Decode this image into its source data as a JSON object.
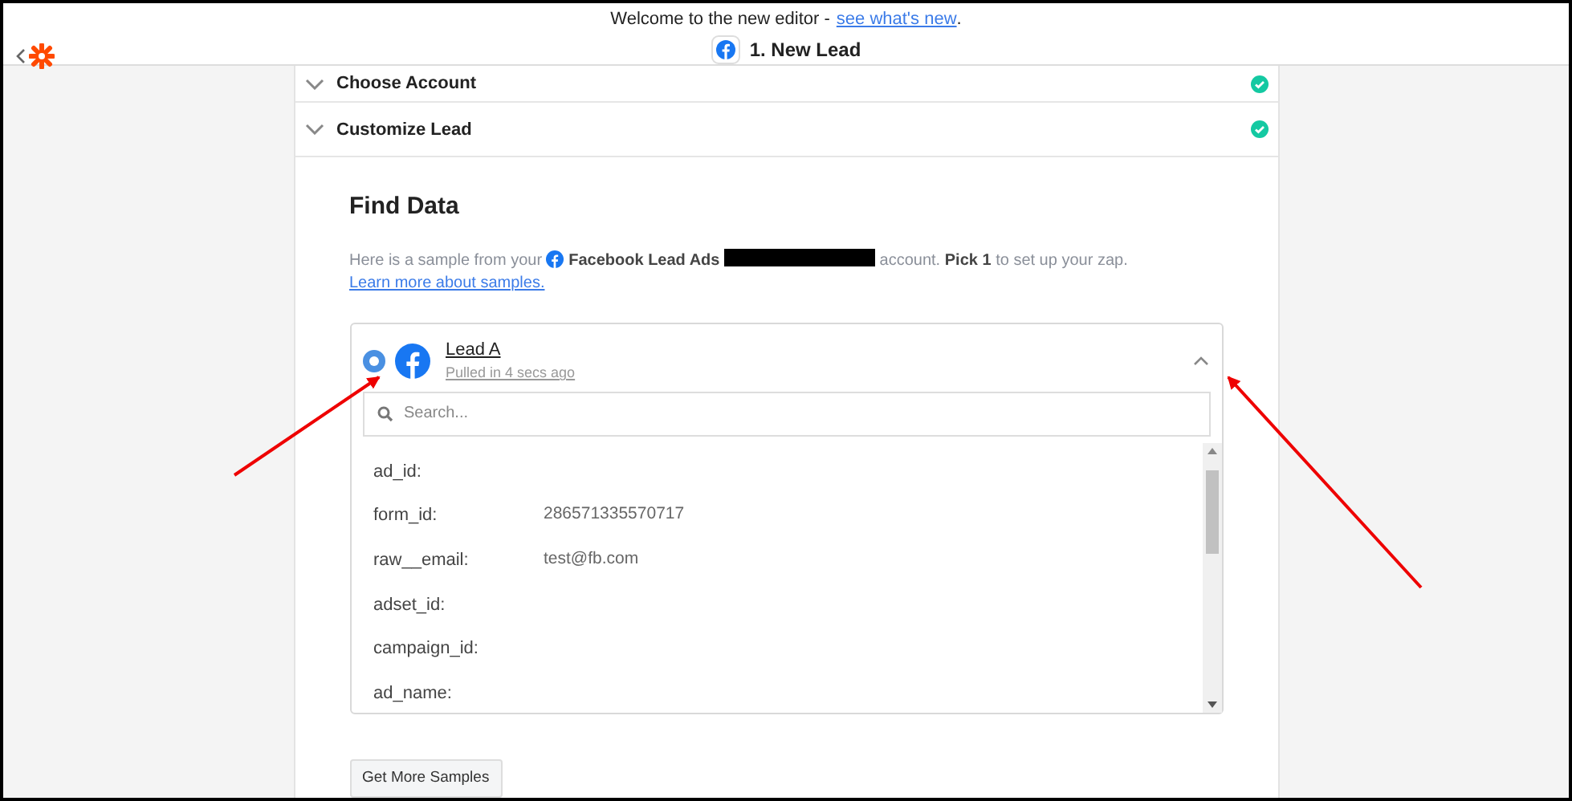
{
  "banner": {
    "text": "Welcome to the new editor -",
    "link": "see what's new",
    "after": "."
  },
  "header": {
    "title": "1. New Lead"
  },
  "steps": [
    {
      "label": "Choose Account",
      "done": true,
      "expanded": false
    },
    {
      "label": "Customize Lead",
      "done": true,
      "expanded": false
    }
  ],
  "find_data": {
    "title": "Find Data",
    "intro": [
      {
        "kind": "text",
        "text": "Here is a sample from your"
      },
      {
        "kind": "app",
        "text": "Facebook Lead Ads"
      },
      {
        "kind": "redacted"
      },
      {
        "kind": "text",
        "text": "account. **Pick 1** to set up your zap."
      },
      {
        "kind": "link",
        "text": "Learn more about samples."
      }
    ],
    "sample": {
      "title": "Lead A",
      "subtitle": "Pulled in 4 secs ago",
      "selected": true,
      "expanded": true
    },
    "search": {
      "placeholder": "Search..."
    },
    "fields": [
      {
        "key": "ad_id:"
      },
      {
        "key": "form_id:",
        "value": "286571335570717"
      },
      {
        "key": "raw__email:",
        "value": "test@fb.com"
      },
      {
        "key": "adset_id:"
      },
      {
        "key": "campaign_id:"
      },
      {
        "key": "ad_name:"
      }
    ],
    "more_button": "Get More Samples"
  }
}
